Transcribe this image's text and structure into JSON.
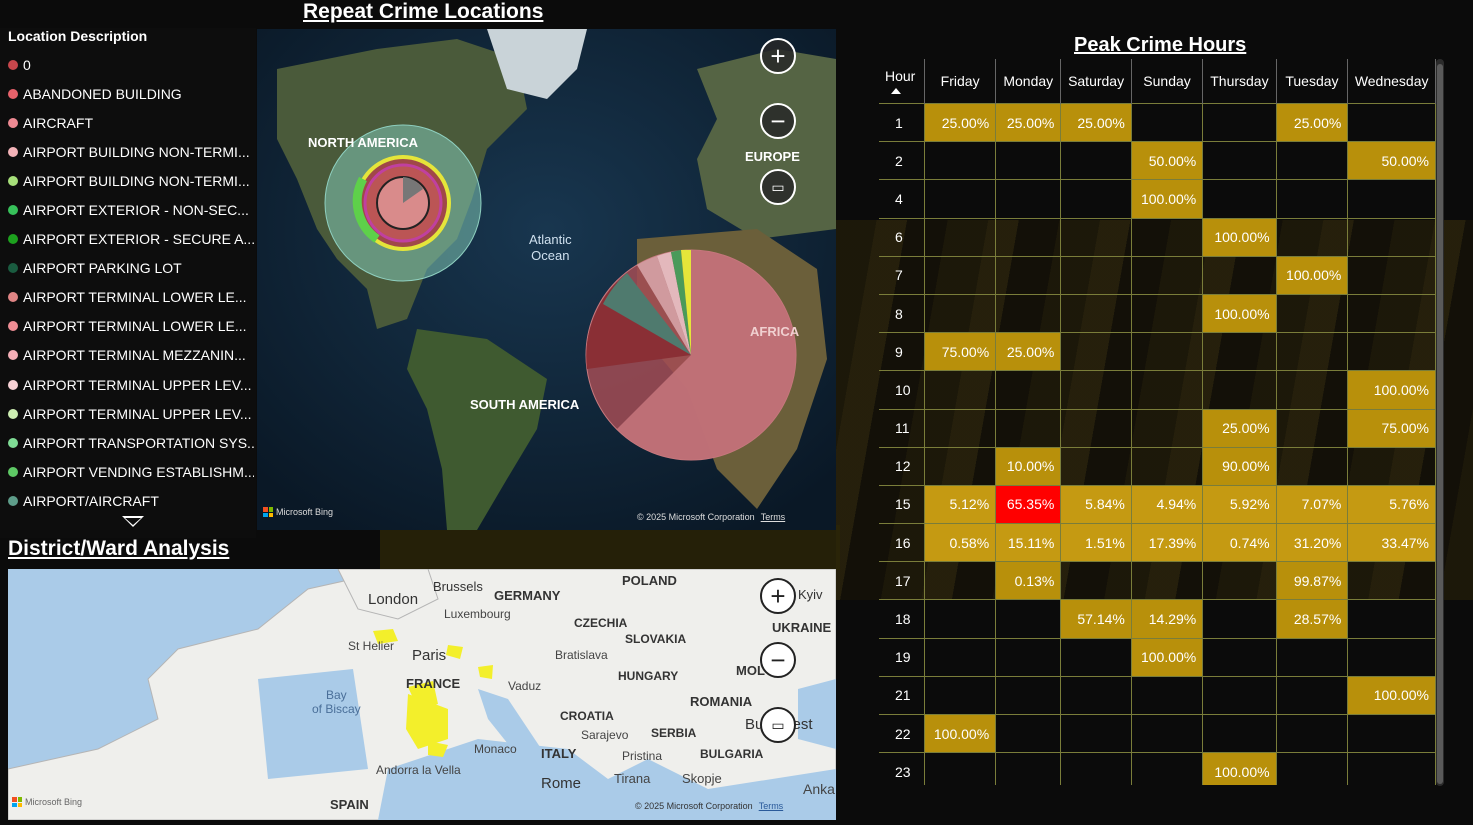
{
  "titles": {
    "repeat": "Repeat Crime Locations",
    "district": "District/Ward Analysis",
    "peak": "Peak Crime Hours"
  },
  "legend": {
    "title": "Location Description",
    "items": [
      {
        "label": "0",
        "color": "#c8474c"
      },
      {
        "label": "ABANDONED BUILDING",
        "color": "#e8626b"
      },
      {
        "label": "AIRCRAFT",
        "color": "#ee8a93"
      },
      {
        "label": "AIRPORT BUILDING NON-TERMI...",
        "color": "#f3b3b8"
      },
      {
        "label": "AIRPORT BUILDING NON-TERMI...",
        "color": "#a7e07a"
      },
      {
        "label": "AIRPORT EXTERIOR - NON-SEC...",
        "color": "#37c15a"
      },
      {
        "label": "AIRPORT EXTERIOR - SECURE A...",
        "color": "#1da11e"
      },
      {
        "label": "AIRPORT PARKING LOT",
        "color": "#1a5c40"
      },
      {
        "label": "AIRPORT TERMINAL LOWER LE...",
        "color": "#e08585"
      },
      {
        "label": "AIRPORT TERMINAL LOWER LE...",
        "color": "#ef8e95"
      },
      {
        "label": "AIRPORT TERMINAL MEZZANIN...",
        "color": "#f4aeb6"
      },
      {
        "label": "AIRPORT TERMINAL UPPER LEV...",
        "color": "#f8d2d6"
      },
      {
        "label": "AIRPORT TERMINAL UPPER LEV...",
        "color": "#cdeeb2"
      },
      {
        "label": "AIRPORT TRANSPORTATION SYS...",
        "color": "#7fdc95"
      },
      {
        "label": "AIRPORT VENDING ESTABLISHM...",
        "color": "#5ec965"
      },
      {
        "label": "AIRPORT/AIRCRAFT",
        "color": "#5e9d8a"
      }
    ]
  },
  "map1": {
    "labels": {
      "north_america": "NORTH AMERICA",
      "europe": "EUROPE",
      "atlantic": "Atlantic\nOcean",
      "africa": "AFRICA",
      "south_america": "SOUTH AMERICA"
    },
    "bing": "Microsoft Bing",
    "copyright": "© 2025 Microsoft Corporation",
    "terms": "Terms"
  },
  "map2": {
    "labels": {
      "brussels": "Brussels",
      "london": "London",
      "germany": "GERMANY",
      "poland": "POLAND",
      "kiev": "Kyiv",
      "luxembourg": "Luxembourg",
      "czechia": "CZECHIA",
      "ukraine": "UKRAINE",
      "sthelier": "St Helier",
      "paris": "Paris",
      "slovakia": "SLOVAKIA",
      "bratislava": "Bratislava",
      "france": "FRANCE",
      "vaduz": "Vaduz",
      "hungary": "HUNGARY",
      "mol": "MOL",
      "bay": "Bay\nof Biscay",
      "romania": "ROMANIA",
      "croatia": "CROATIA",
      "sarajevo": "Sarajevo",
      "serbia": "SERBIA",
      "bucharest": "Bucharest",
      "monaco": "Monaco",
      "italy": "ITALY",
      "pristina": "Pristina",
      "bulgaria": "BULGARIA",
      "andorra": "Andorra la Vella",
      "tirana": "Tirana",
      "skopje": "Skopje",
      "rome": "Rome",
      "spain": "SPAIN",
      "ankara": "Anka"
    },
    "bing": "Microsoft Bing",
    "copyright": "© 2025 Microsoft Corporation",
    "terms": "Terms"
  },
  "matrix": {
    "columns": [
      "Hour",
      "Friday",
      "Monday",
      "Saturday",
      "Sunday",
      "Thursday",
      "Tuesday",
      "Wednesday"
    ],
    "rows": [
      [
        "1",
        "25.00%",
        "25.00%",
        "25.00%",
        "",
        "",
        "25.00%",
        ""
      ],
      [
        "2",
        "",
        "",
        "",
        "50.00%",
        "",
        "",
        "50.00%"
      ],
      [
        "4",
        "",
        "",
        "",
        "100.00%",
        "",
        "",
        ""
      ],
      [
        "6",
        "",
        "",
        "",
        "",
        "100.00%",
        "",
        ""
      ],
      [
        "7",
        "",
        "",
        "",
        "",
        "",
        "100.00%",
        ""
      ],
      [
        "8",
        "",
        "",
        "",
        "",
        "100.00%",
        "",
        ""
      ],
      [
        "9",
        "75.00%",
        "25.00%",
        "",
        "",
        "",
        "",
        ""
      ],
      [
        "10",
        "",
        "",
        "",
        "",
        "",
        "",
        "100.00%"
      ],
      [
        "11",
        "",
        "",
        "",
        "",
        "25.00%",
        "",
        "75.00%"
      ],
      [
        "12",
        "",
        "10.00%",
        "",
        "",
        "90.00%",
        "",
        ""
      ],
      [
        "15",
        "5.12%",
        "65.35%",
        "5.84%",
        "4.94%",
        "5.92%",
        "7.07%",
        "5.76%"
      ],
      [
        "16",
        "0.58%",
        "15.11%",
        "1.51%",
        "17.39%",
        "0.74%",
        "31.20%",
        "33.47%"
      ],
      [
        "17",
        "",
        "0.13%",
        "",
        "",
        "",
        "99.87%",
        ""
      ],
      [
        "18",
        "",
        "",
        "57.14%",
        "14.29%",
        "",
        "28.57%",
        ""
      ],
      [
        "19",
        "",
        "",
        "",
        "100.00%",
        "",
        "",
        ""
      ],
      [
        "21",
        "",
        "",
        "",
        "",
        "",
        "",
        "100.00%"
      ],
      [
        "22",
        "100.00%",
        "",
        "",
        "",
        "",
        "",
        ""
      ],
      [
        "23",
        "",
        "",
        "",
        "",
        "100.00%",
        "",
        ""
      ]
    ],
    "highlight": "65.35%",
    "colors": {
      "cell": "#b8900b",
      "highlight": "#ff0000"
    }
  }
}
